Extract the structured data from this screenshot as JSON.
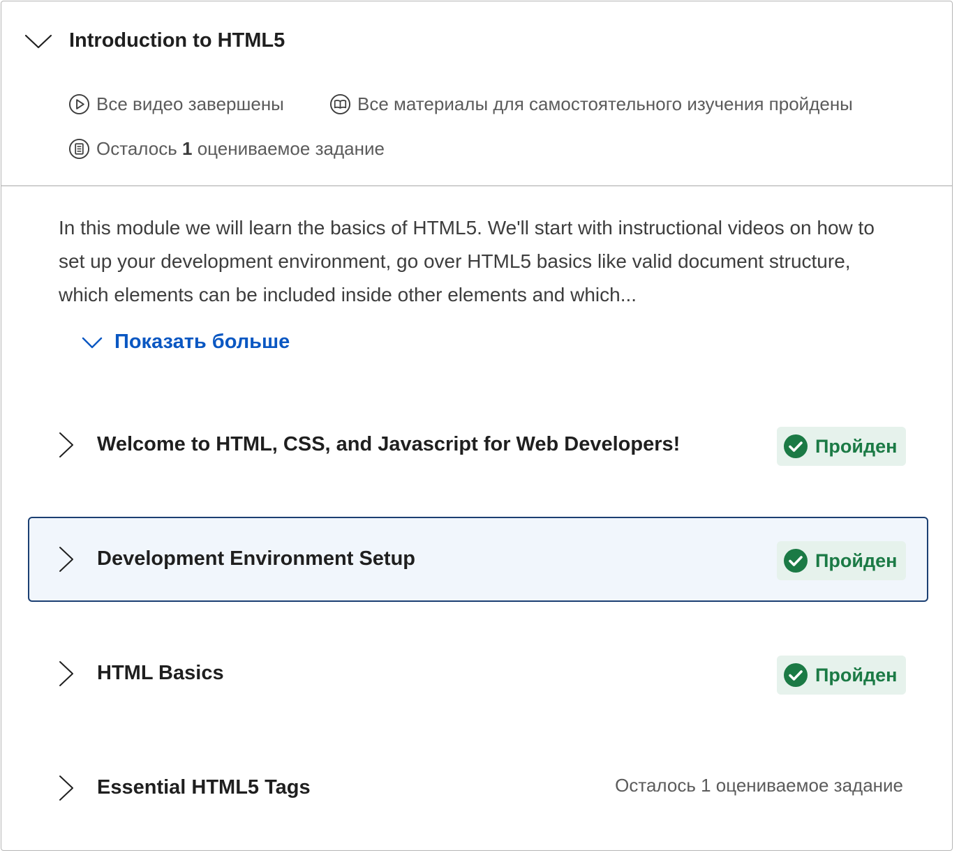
{
  "module": {
    "title": "Introduction to HTML5",
    "stats": {
      "videos": "Все видео завершены",
      "readings": "Все материалы для самостоятельного изучения пройдены",
      "graded_prefix": "Осталось",
      "graded_count": "1",
      "graded_suffix": "оцениваемое задание"
    },
    "description": "In this module we will learn the basics of HTML5. We'll start with instructional videos on how to set up your development environment, go over HTML5 basics like valid document structure, which elements can be included inside other elements and which...",
    "show_more_label": "Показать больше"
  },
  "lessons": [
    {
      "title": "Welcome to HTML, CSS, and Javascript for Web Developers!",
      "status": "Пройден",
      "completed": true
    },
    {
      "title": "Development Environment Setup",
      "status": "Пройден",
      "completed": true
    },
    {
      "title": "HTML Basics",
      "status": "Пройден",
      "completed": true
    },
    {
      "title": "Essential HTML5 Tags",
      "status": "Осталось 1 оцениваемое задание",
      "completed": false
    }
  ],
  "colors": {
    "accent_link": "#0a57c2",
    "success_text": "#1b7a45",
    "success_bg": "#e6f2ec",
    "focus_border": "#1b3f72",
    "focus_bg": "#f1f6fc"
  },
  "icons": {
    "collapse": "chevron-down-icon",
    "lesson_expand": "chevron-right-icon",
    "videos": "play-circle-icon",
    "readings": "book-icon",
    "graded": "assignment-icon",
    "completed": "check-circle-icon"
  }
}
